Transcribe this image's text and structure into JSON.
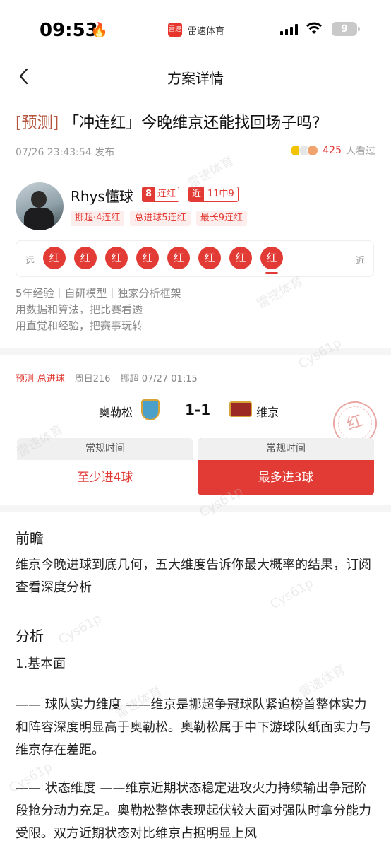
{
  "status_bar": {
    "time": "09:53",
    "app_name": "雷速体育",
    "app_logo": "雷速",
    "battery": "9"
  },
  "nav": {
    "title": "方案详情"
  },
  "article": {
    "tag": "[预测]",
    "title": "「冲连红」今晚维京还能找回场子吗?",
    "published": "07/26 23:43:54 发布",
    "views_num": "425",
    "views_suffix": "人看过"
  },
  "author": {
    "name": "Rhys懂球",
    "streak_count": "8",
    "streak_label": "连红",
    "recent_prefix": "近",
    "recent_value": "11中9",
    "tags": [
      "挪超·4连红",
      "总进球5连红",
      "最长9连红"
    ],
    "record_far": "远",
    "record_near": "近",
    "record": [
      "红",
      "红",
      "红",
      "红",
      "红",
      "红",
      "红",
      "红"
    ],
    "bio": [
      "5年经验｜自研模型｜独家分析框架",
      "用数据和算法，把比赛看透",
      "用直觉和经验，把赛事玩转"
    ]
  },
  "match": {
    "category": "预测-总进球",
    "code": "周日216",
    "league": "挪超",
    "time": "07/27 01:15",
    "home": "奥勒松",
    "score": "1-1",
    "away": "维京",
    "stamp": "红",
    "options": [
      {
        "period": "常规时间",
        "label": "至少进4球",
        "selected": false
      },
      {
        "period": "常规时间",
        "label": "最多进3球",
        "selected": true
      }
    ]
  },
  "content": {
    "preview_heading": "前瞻",
    "preview_text": "维京今晚进球到底几何，五大维度告诉你最大概率的结果，订阅查看深度分析",
    "analysis_heading": "分析",
    "section1": "1.基本面",
    "para1": "—— 球队实力维度 ——维京是挪超争冠球队紧追榜首整体实力和阵容深度明显高于奥勒松。奥勒松属于中下游球队纸面实力与维京存在差距。",
    "para2": "—— 状态维度 ——维京近期状态稳定进攻火力持续输出争冠阶段抢分动力充足。奥勒松整体表现起伏较大面对强队时拿分能力受限。双方近期状态对比维京占据明显上风"
  },
  "watermark": {
    "brand": "雷速体育",
    "user": "Cys61p"
  },
  "colors": {
    "accent": "#e23b35",
    "tag_brown": "#b5533c"
  }
}
